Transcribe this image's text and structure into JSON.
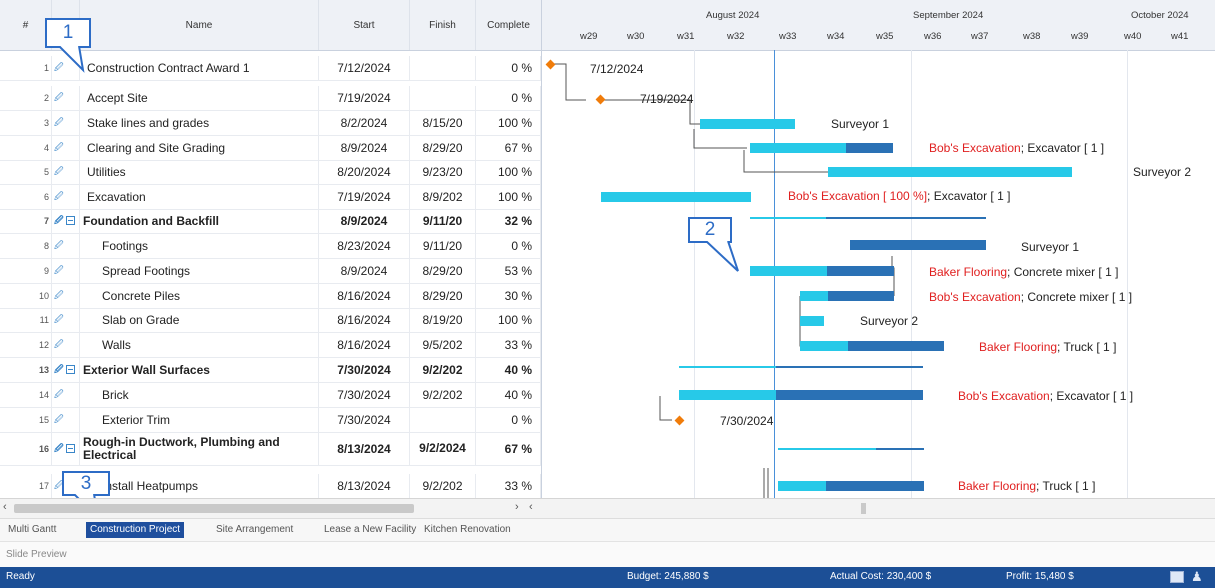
{
  "grid": {
    "headers": {
      "num": "#",
      "name": "Name",
      "start": "Start",
      "finish": "Finish",
      "complete": "Complete"
    },
    "rows": [
      {
        "num": "1",
        "name": "Construction Contract Award 1",
        "start": "7/12/2024",
        "finish": "",
        "complete": "0 %"
      },
      {
        "num": "2",
        "name": "Accept Site",
        "start": "7/19/2024",
        "finish": "",
        "complete": "0 %"
      },
      {
        "num": "3",
        "name": "Stake lines and grades",
        "start": "8/2/2024",
        "finish": "8/15/20",
        "complete": "100 %"
      },
      {
        "num": "4",
        "name": "Clearing and Site Grading",
        "start": "8/9/2024",
        "finish": "8/29/20",
        "complete": "67 %"
      },
      {
        "num": "5",
        "name": "Utilities",
        "start": "8/20/2024",
        "finish": "9/23/20",
        "complete": "100 %"
      },
      {
        "num": "6",
        "name": "Excavation",
        "start": "7/19/2024",
        "finish": "8/9/202",
        "complete": "100 %"
      },
      {
        "num": "7",
        "name": "Foundation and Backfill",
        "start": "8/9/2024",
        "finish": "9/11/20",
        "complete": "32 %"
      },
      {
        "num": "8",
        "name": "Footings",
        "start": "8/23/2024",
        "finish": "9/11/20",
        "complete": "0 %"
      },
      {
        "num": "9",
        "name": "Spread Footings",
        "start": "8/9/2024",
        "finish": "8/29/20",
        "complete": "53 %"
      },
      {
        "num": "10",
        "name": "Concrete Piles",
        "start": "8/16/2024",
        "finish": "8/29/20",
        "complete": "30 %"
      },
      {
        "num": "11",
        "name": "Slab on Grade",
        "start": "8/16/2024",
        "finish": "8/19/20",
        "complete": "100 %"
      },
      {
        "num": "12",
        "name": "Walls",
        "start": "8/16/2024",
        "finish": "9/5/202",
        "complete": "33 %"
      },
      {
        "num": "13",
        "name": "Exterior Wall Surfaces",
        "start": "7/30/2024",
        "finish": "9/2/202",
        "complete": "40 %"
      },
      {
        "num": "14",
        "name": "Brick",
        "start": "7/30/2024",
        "finish": "9/2/202",
        "complete": "40 %"
      },
      {
        "num": "15",
        "name": "Exterior Trim",
        "start": "7/30/2024",
        "finish": "",
        "complete": "0 %"
      },
      {
        "num": "16",
        "name": "Rough-in Ductwork, Plumbing and Electrical",
        "start": "8/13/2024",
        "finish": "9/2/2024",
        "complete": "67 %"
      },
      {
        "num": "17",
        "name": "Install Heatpumps",
        "start": "8/13/2024",
        "finish": "9/2/202",
        "complete": "33 %"
      }
    ]
  },
  "chart": {
    "months": [
      "August 2024",
      "September 2024",
      "October 2024"
    ],
    "weeks": [
      "w29",
      "w30",
      "w31",
      "w32",
      "w33",
      "w34",
      "w35",
      "w36",
      "w37",
      "w38",
      "w39",
      "w40",
      "w41"
    ],
    "labels": {
      "r1": "7/12/2024",
      "r2": "7/19/2024",
      "r3": "Surveyor 1",
      "r4_red": "Bob's Excavation",
      "r4_rest": "; Excavator [ 1 ]",
      "r5": "Surveyor 2",
      "r6_red": "Bob's Excavation [ 100 %]",
      "r6_rest": "; Excavator [ 1 ]",
      "r8": "Surveyor 1",
      "r9_red": "Baker Flooring",
      "r9_rest": "; Concrete mixer [ 1 ]",
      "r10_red": "Bob's Excavation",
      "r10_rest": "; Concrete mixer [ 1 ]",
      "r11": "Surveyor 2",
      "r12_red": "Baker Flooring",
      "r12_rest": "; Truck [ 1 ]",
      "r14_red": "Bob's Excavation",
      "r14_rest": "; Excavator [ 1 ]",
      "r15": "7/30/2024",
      "r17_red": "Baker Flooring",
      "r17_rest": "; Truck [ 1 ]"
    }
  },
  "callouts": [
    "1",
    "2",
    "3"
  ],
  "tabs": [
    "Multi Gantt",
    "Construction Project",
    "Site Arrangement",
    "Lease a New Facility",
    "Kitchen Renovation"
  ],
  "active_tab": "Construction Project",
  "slide_preview": "Slide Preview",
  "status": {
    "ready": "Ready",
    "budget": "Budget: 245,880 $",
    "actual_cost": "Actual Cost: 230,400 $",
    "profit": "Profit: 15,480 $"
  },
  "colors": {
    "accent": "#1c4f96",
    "bar": "#27c9e8",
    "progress": "#2a71b5",
    "milestone": "#f07c0a",
    "resource": "#e02020"
  }
}
